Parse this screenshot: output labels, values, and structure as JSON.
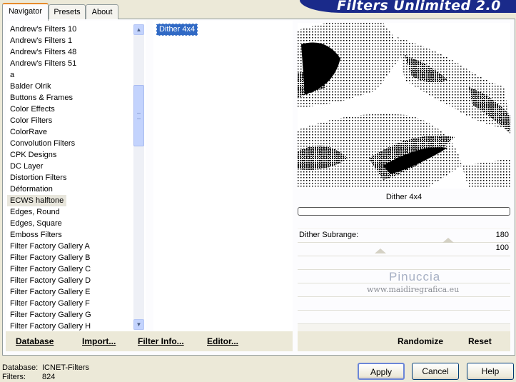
{
  "header": {
    "title": "Filters Unlimited 2.0"
  },
  "tabs": [
    {
      "label": "Navigator",
      "active": true
    },
    {
      "label": "Presets",
      "active": false
    },
    {
      "label": "About",
      "active": false
    }
  ],
  "filter_categories": [
    "Andrew's Filters 10",
    "Andrew's Filters 1",
    "Andrew's Filters 48",
    "Andrew's Filters 51",
    "a",
    "Balder Olrik",
    "Buttons & Frames",
    "Color Effects",
    "Color Filters",
    "ColorRave",
    "Convolution Filters",
    "CPK Designs",
    "DC Layer",
    "Distortion Filters",
    "Déformation",
    "ECWS halftone",
    "Edges, Round",
    "Edges, Square",
    "Emboss Filters",
    "Filter Factory Gallery A",
    "Filter Factory Gallery B",
    "Filter Factory Gallery C",
    "Filter Factory Gallery D",
    "Filter Factory Gallery E",
    "Filter Factory Gallery F",
    "Filter Factory Gallery G",
    "Filter Factory Gallery H"
  ],
  "selected_category": "ECWS halftone",
  "effects": [
    "Dither 4x4"
  ],
  "preview": {
    "filter_name": "Dither 4x4"
  },
  "parameters": [
    {
      "label": "Dither Subrange:",
      "value": "180"
    },
    {
      "label": "",
      "value": "100"
    }
  ],
  "watermark": {
    "name": "Pinuccia",
    "url": "www.maidiregrafica.eu"
  },
  "toolbar": {
    "database": "Database",
    "import": "Import...",
    "filter_info": "Filter Info...",
    "editor": "Editor...",
    "randomize": "Randomize",
    "reset": "Reset"
  },
  "footer": {
    "database_label": "Database:",
    "database_value": "ICNET-Filters",
    "filters_label": "Filters:",
    "filters_value": "824"
  },
  "buttons": {
    "apply": "Apply",
    "cancel": "Cancel",
    "help": "Help"
  },
  "colors": {
    "accent": "#316ac5",
    "banner": "#1a2a8a",
    "tab_highlight": "#e68b2c"
  }
}
